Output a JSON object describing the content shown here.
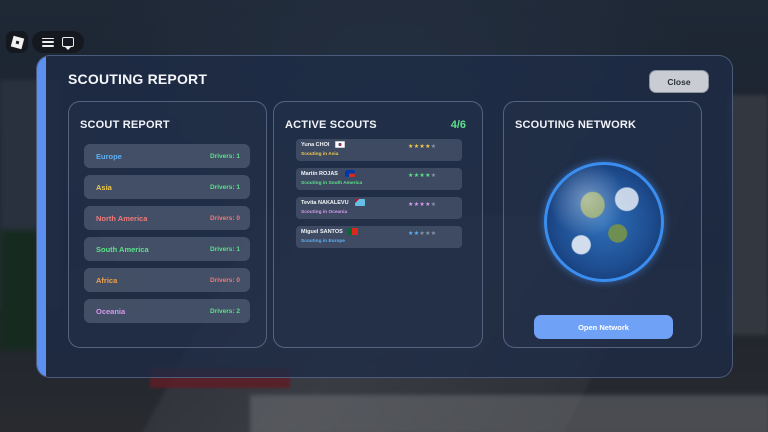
{
  "panel": {
    "title": "SCOUTING REPORT",
    "close_label": "Close"
  },
  "scout_report": {
    "title": "SCOUT REPORT",
    "regions": [
      {
        "name": "Europe",
        "drivers": "Drivers: 1",
        "name_color": "#5fb0f5",
        "count_color": "#5ee08a"
      },
      {
        "name": "Asia",
        "drivers": "Drivers: 1",
        "name_color": "#f2c94c",
        "count_color": "#5ee08a"
      },
      {
        "name": "North America",
        "drivers": "Drivers: 0",
        "name_color": "#f07a7a",
        "count_color": "#f07a7a"
      },
      {
        "name": "South America",
        "drivers": "Drivers: 1",
        "name_color": "#5ee08a",
        "count_color": "#5ee08a"
      },
      {
        "name": "Africa",
        "drivers": "Drivers: 0",
        "name_color": "#f2a24c",
        "count_color": "#f07a7a"
      },
      {
        "name": "Oceania",
        "drivers": "Drivers: 2",
        "name_color": "#d79af0",
        "count_color": "#5ee08a"
      }
    ]
  },
  "active_scouts": {
    "title": "ACTIVE SCOUTS",
    "count": "4/6",
    "scouts": [
      {
        "name": "Yuna CHOI",
        "location": "Scouting in Asia",
        "loc_color": "#f2c94c",
        "flag": "kr-flag-icon",
        "rating": 4,
        "star_color": "#f2c94c"
      },
      {
        "name": "Martín ROJAS",
        "location": "Scouting in South America",
        "loc_color": "#5ee08a",
        "flag": "cl-flag-icon",
        "rating": 4,
        "star_color": "#5ee08a"
      },
      {
        "name": "Tevita NAKALEVU",
        "location": "Scouting in Oceania",
        "loc_color": "#d79af0",
        "flag": "fj-flag-icon",
        "rating": 4,
        "star_color": "#d79af0"
      },
      {
        "name": "Miguel SANTOS",
        "location": "Scouting in Europe",
        "loc_color": "#5fb0f5",
        "flag": "pt-flag-icon",
        "rating": 2,
        "star_color": "#5fb0f5"
      }
    ]
  },
  "network": {
    "title": "SCOUTING NETWORK",
    "globe": "earth-globe-icon",
    "open_label": "Open Network"
  },
  "colors": {
    "accent": "#5c8ff0",
    "positive": "#5ee08a",
    "negative": "#f07a7a"
  }
}
